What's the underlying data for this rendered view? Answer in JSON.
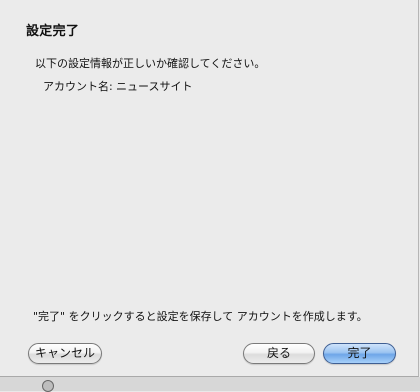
{
  "dialog": {
    "title": "設定完了",
    "info_text": "以下の設定情報が正しいか確認してください。",
    "account_label": "アカウント名:",
    "account_value": "ニュースサイト",
    "footer_text": "\"完了\" をクリックすると設定を保存して アカウントを作成します。"
  },
  "buttons": {
    "cancel_label": "キャンセル",
    "back_label": "戻る",
    "done_label": "完了"
  },
  "colors": {
    "default_button": "#8dbbf0",
    "background": "#ebebeb"
  }
}
